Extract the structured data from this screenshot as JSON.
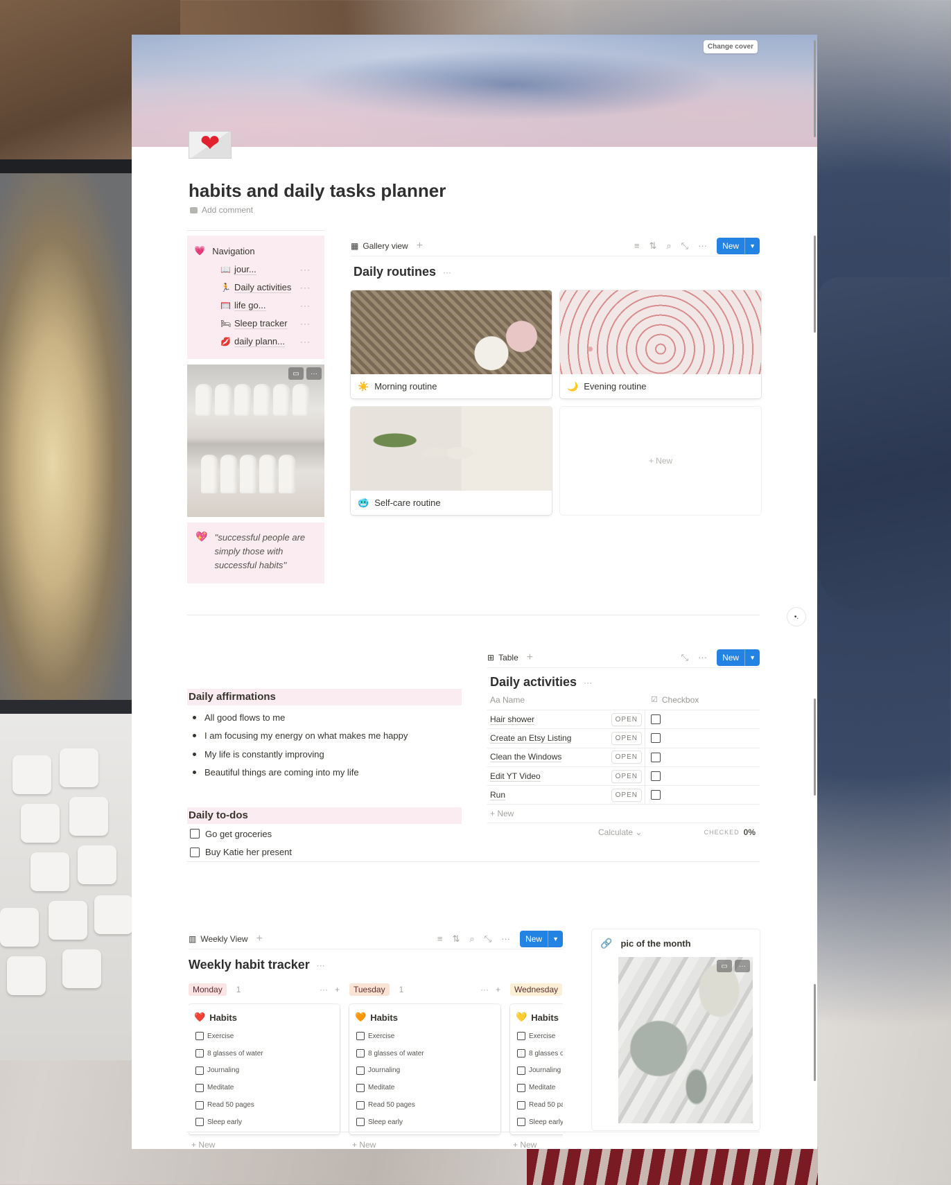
{
  "cover": {
    "change_cover_label": "Change cover"
  },
  "page": {
    "icon": "love-letter-icon",
    "title": "habits and daily tasks planner",
    "add_comment": "Add comment"
  },
  "navigation": {
    "heading_icon": "pink-heart-icon",
    "heading": "Navigation",
    "items": [
      {
        "icon": "book-icon",
        "glyph": "📖",
        "label": "jour..."
      },
      {
        "icon": "runner-icon",
        "glyph": "🏃",
        "label": "Daily activities"
      },
      {
        "icon": "goal-box-icon",
        "glyph": "🥅",
        "label": "life go..."
      },
      {
        "icon": "bed-icon",
        "glyph": "🛏",
        "label": "Sleep tracker"
      },
      {
        "icon": "kiss-lips-icon",
        "glyph": "💋",
        "label": "daily plann..."
      }
    ],
    "more_glyph": "···"
  },
  "quote": {
    "icon": "sparkling-heart-icon",
    "text": "''successful people are simply those with successful habits''"
  },
  "gallery": {
    "view_label": "Gallery view",
    "add_view": "+",
    "new_label": "New",
    "title": "Daily routines",
    "cards": [
      {
        "icon": "sun-icon",
        "glyph": "☀️",
        "label": "Morning routine"
      },
      {
        "icon": "crescent-moon-icon",
        "glyph": "🌙",
        "label": "Evening routine"
      },
      {
        "icon": "cold-face-icon",
        "glyph": "🥶",
        "label": "Self-care routine"
      }
    ],
    "new_card_label": "+ New"
  },
  "affirmations": {
    "heading": "Daily affirmations",
    "items": [
      "All good flows to me",
      "I am focusing my energy on what makes me happy",
      "My life is constantly improving",
      "Beautiful things are coming into my life"
    ]
  },
  "todos": {
    "heading": "Daily to-dos",
    "items": [
      {
        "label": "Go get groceries",
        "checked": false
      },
      {
        "label": "Buy Katie her present",
        "checked": false
      }
    ]
  },
  "activities_table": {
    "view_label": "Table",
    "add_view": "+",
    "new_label": "New",
    "title": "Daily activities",
    "columns": {
      "name": "Aa Name",
      "checkbox": "Checkbox"
    },
    "open_label": "OPEN",
    "rows": [
      {
        "name": "Hair shower",
        "checked": false
      },
      {
        "name": "Create an Etsy Listing",
        "checked": false
      },
      {
        "name": "Clean the Windows",
        "checked": false
      },
      {
        "name": "Edit YT Video",
        "checked": false
      },
      {
        "name": "Run",
        "checked": false
      }
    ],
    "add_row": "+ New",
    "calculate": "Calculate ⌄",
    "checked_label": "CHECKED",
    "checked_value": "0%"
  },
  "weekly": {
    "view_label": "Weekly View",
    "add_view": "+",
    "new_label": "New",
    "title": "Weekly habit tracker",
    "columns": [
      {
        "day": "Monday",
        "count": "1",
        "tag_color": "#fbe4e4",
        "card_icon": "red-heart-icon",
        "card_glyph": "❤️"
      },
      {
        "day": "Tuesday",
        "count": "1",
        "tag_color": "#fbe4d6",
        "card_icon": "orange-heart-icon",
        "card_glyph": "🧡"
      },
      {
        "day": "Wednesday",
        "count": "",
        "tag_color": "#fbf0d6",
        "card_icon": "yellow-heart-icon",
        "card_glyph": "💛"
      }
    ],
    "card_title": "Habits",
    "habits": [
      "Exercise",
      "8 glasses of water",
      "Journaling",
      "Meditate",
      "Read 50 pages",
      "Sleep early"
    ],
    "add_card": "+ New"
  },
  "pic_of_month": {
    "icon": "link-icon",
    "title": "pic of the month"
  }
}
